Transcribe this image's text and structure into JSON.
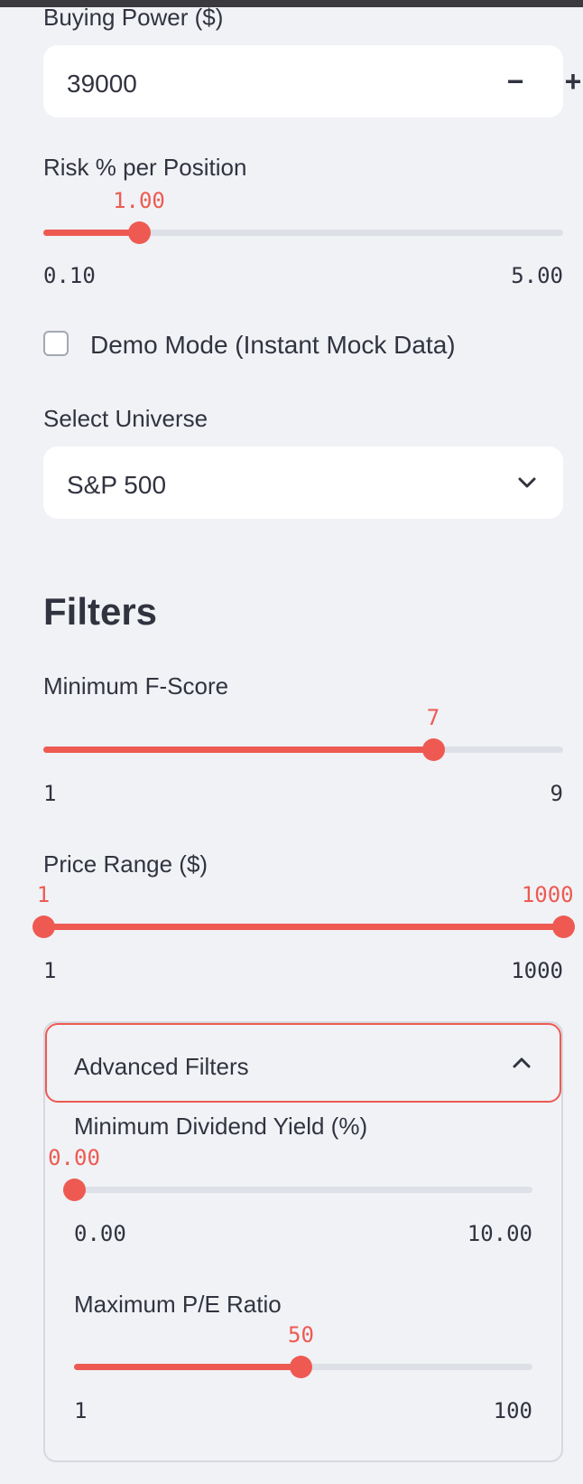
{
  "buying_power": {
    "label": "Buying Power ($)",
    "value": "39000",
    "minus_label": "−",
    "plus_label": "+"
  },
  "risk": {
    "label": "Risk % per Position",
    "value": "1.00",
    "min": "0.10",
    "max": "5.00",
    "position": 0.184
  },
  "demo_mode": {
    "label": "Demo Mode (Instant Mock Data)",
    "checked": false
  },
  "universe": {
    "label": "Select Universe",
    "value": "S&P 500",
    "icon": "chevron-down-icon"
  },
  "filters": {
    "heading": "Filters",
    "fscore": {
      "label": "Minimum F-Score",
      "value": "7",
      "min": "1",
      "max": "9",
      "position": 0.75
    },
    "price_range": {
      "label": "Price Range ($)",
      "low_value": "1",
      "high_value": "1000",
      "min": "1",
      "max": "1000",
      "low_position": 0,
      "high_position": 1
    },
    "advanced": {
      "label": "Advanced Filters",
      "icon": "chevron-up-icon",
      "expanded": true,
      "dividend": {
        "label": "Minimum Dividend Yield (%)",
        "value": "0.00",
        "min": "0.00",
        "max": "10.00",
        "position": 0
      },
      "pe": {
        "label": "Maximum P/E Ratio",
        "value": "50",
        "min": "1",
        "max": "100",
        "position": 0.495
      }
    }
  },
  "colors": {
    "accent": "#ee5a52",
    "background": "#f0f2f6",
    "track": "#dde0e6",
    "text": "#31333f"
  }
}
